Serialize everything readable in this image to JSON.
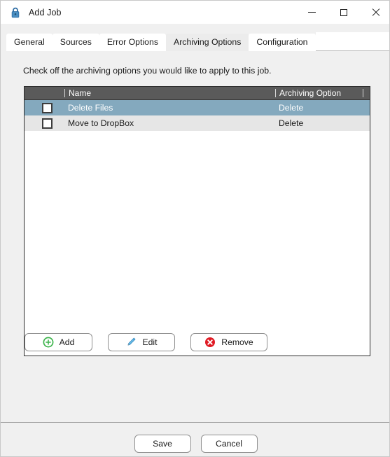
{
  "window": {
    "title": "Add Job",
    "icon": "lock-icon",
    "controls": {
      "minimize": "—",
      "maximize": "□",
      "close": "✕"
    }
  },
  "tabs": [
    {
      "label": "General",
      "active": false
    },
    {
      "label": "Sources",
      "active": false
    },
    {
      "label": "Error Options",
      "active": false
    },
    {
      "label": "Archiving Options",
      "active": true
    },
    {
      "label": "Configuration",
      "active": false
    }
  ],
  "main": {
    "instruction": "Check off the archiving options you would like to apply to this job.",
    "list": {
      "columns": [
        "Name",
        "Archiving Option"
      ],
      "rows": [
        {
          "checked": false,
          "name": "Delete Files",
          "option": "Delete",
          "selected": true
        },
        {
          "checked": false,
          "name": "Move to DropBox",
          "option": "Delete",
          "selected": false
        }
      ]
    },
    "actions": [
      {
        "label": "Add",
        "icon": "plus-circle-icon",
        "color": "#3cb44b"
      },
      {
        "label": "Edit",
        "icon": "pencil-icon",
        "color": "#4aa3df"
      },
      {
        "label": "Remove",
        "icon": "x-circle-icon",
        "color": "#e01b24"
      }
    ]
  },
  "footer": {
    "save_label": "Save",
    "cancel_label": "Cancel"
  },
  "colors": {
    "selection": "#84a9be",
    "header_bar": "#5a5a5a",
    "alt_row": "#e6e6e6",
    "window_bg": "#f0f0f0"
  }
}
